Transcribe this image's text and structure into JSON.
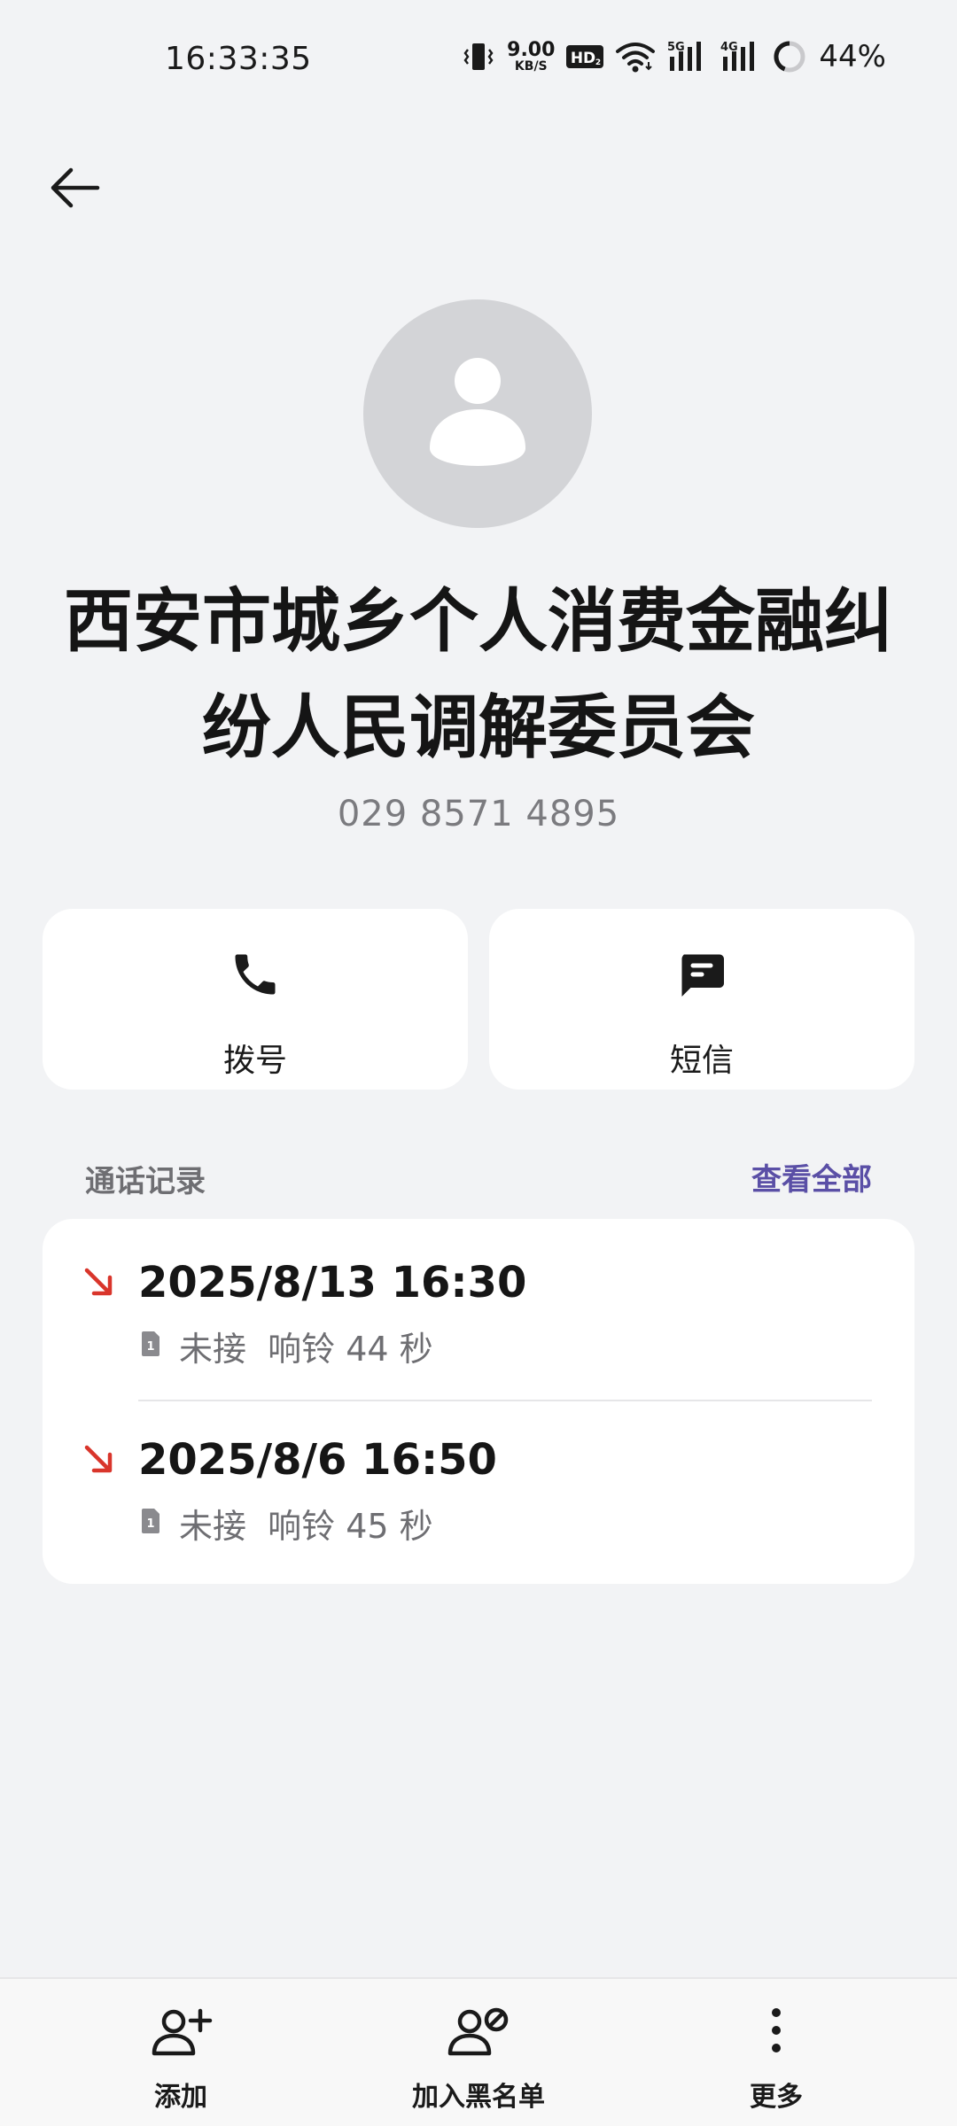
{
  "status_bar": {
    "time": "16:33:35",
    "net_speed_value": "9.00",
    "net_speed_unit": "KB/S",
    "hd_label": "HD",
    "sim1_label": "5G",
    "sim2_label": "4G",
    "battery_percent": "44%"
  },
  "contact": {
    "name": "西安市城乡个人消费金融纠纷人民调解委员会",
    "phone": "029 8571 4895"
  },
  "actions": {
    "dial_label": "拨号",
    "sms_label": "短信"
  },
  "call_log": {
    "title": "通话记录",
    "view_all": "查看全部",
    "entries": [
      {
        "datetime": "2025/8/13 16:30",
        "sim": "1",
        "detail": "未接  响铃 44 秒"
      },
      {
        "datetime": "2025/8/6 16:50",
        "sim": "1",
        "detail": "未接  响铃 45 秒"
      }
    ]
  },
  "bottom_bar": {
    "add_label": "添加",
    "block_label": "加入黑名单",
    "more_label": "更多"
  },
  "colors": {
    "background": "#f2f3f5",
    "card": "#ffffff",
    "accent": "#5a4fa6",
    "missed_call": "#d9352b",
    "avatar": "#d3d4d7"
  }
}
